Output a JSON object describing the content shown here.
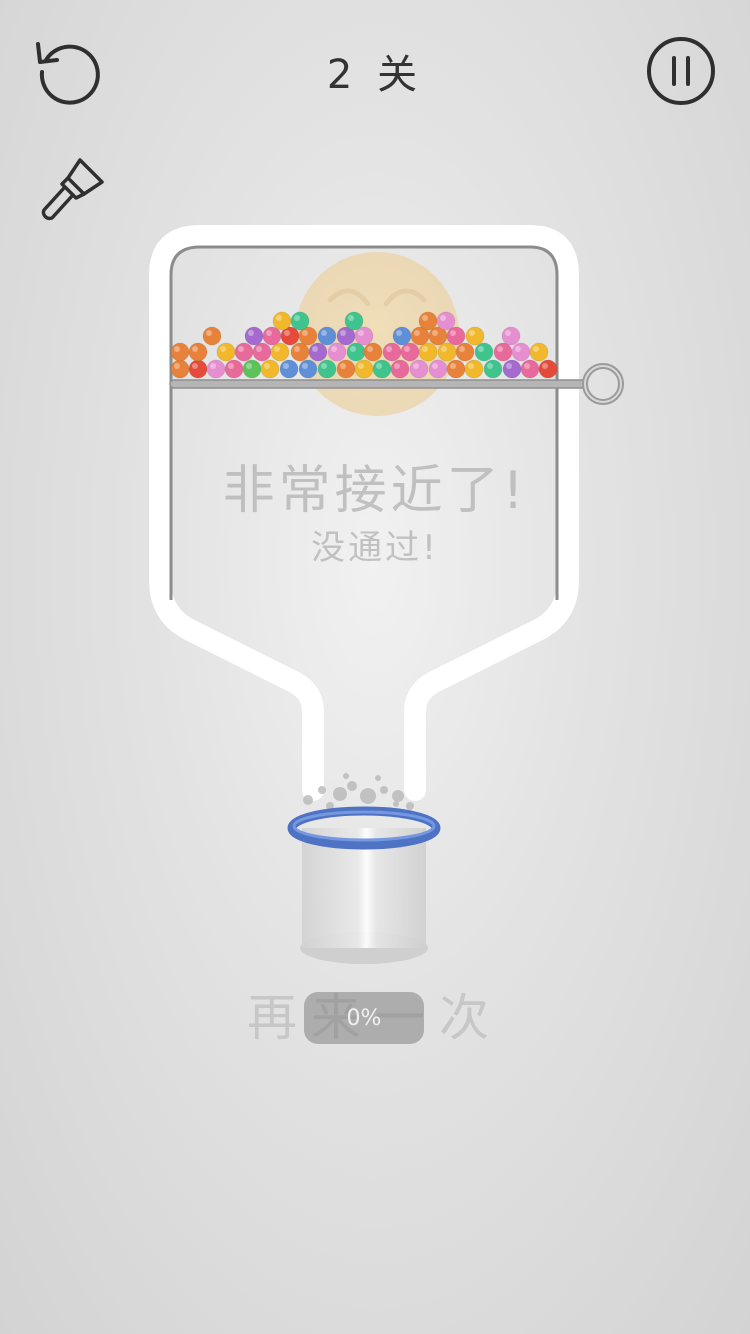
{
  "header": {
    "level_number": "2",
    "level_suffix": "关",
    "restart_icon": "restart-icon",
    "pause_icon": "pause-icon",
    "brush_icon": "brush-icon"
  },
  "messages": {
    "main": "非常接近了!",
    "sub": "没通过!",
    "retry": "再来一次"
  },
  "progress": {
    "label": "0%",
    "value": 0
  },
  "colors": {
    "background": "#dcdcdc",
    "bottle_outline": "#ffffff",
    "pin": "#9a9a9a",
    "cup_rim": "#5b7fcf",
    "text_faded": "#b9b9b9"
  },
  "balls": {
    "palette": [
      "#e8823a",
      "#f0b82a",
      "#e86a9a",
      "#a46ad0",
      "#3fc48e",
      "#5f8fd6",
      "#e44b3b",
      "#e58fd0",
      "#5cc35b"
    ]
  }
}
